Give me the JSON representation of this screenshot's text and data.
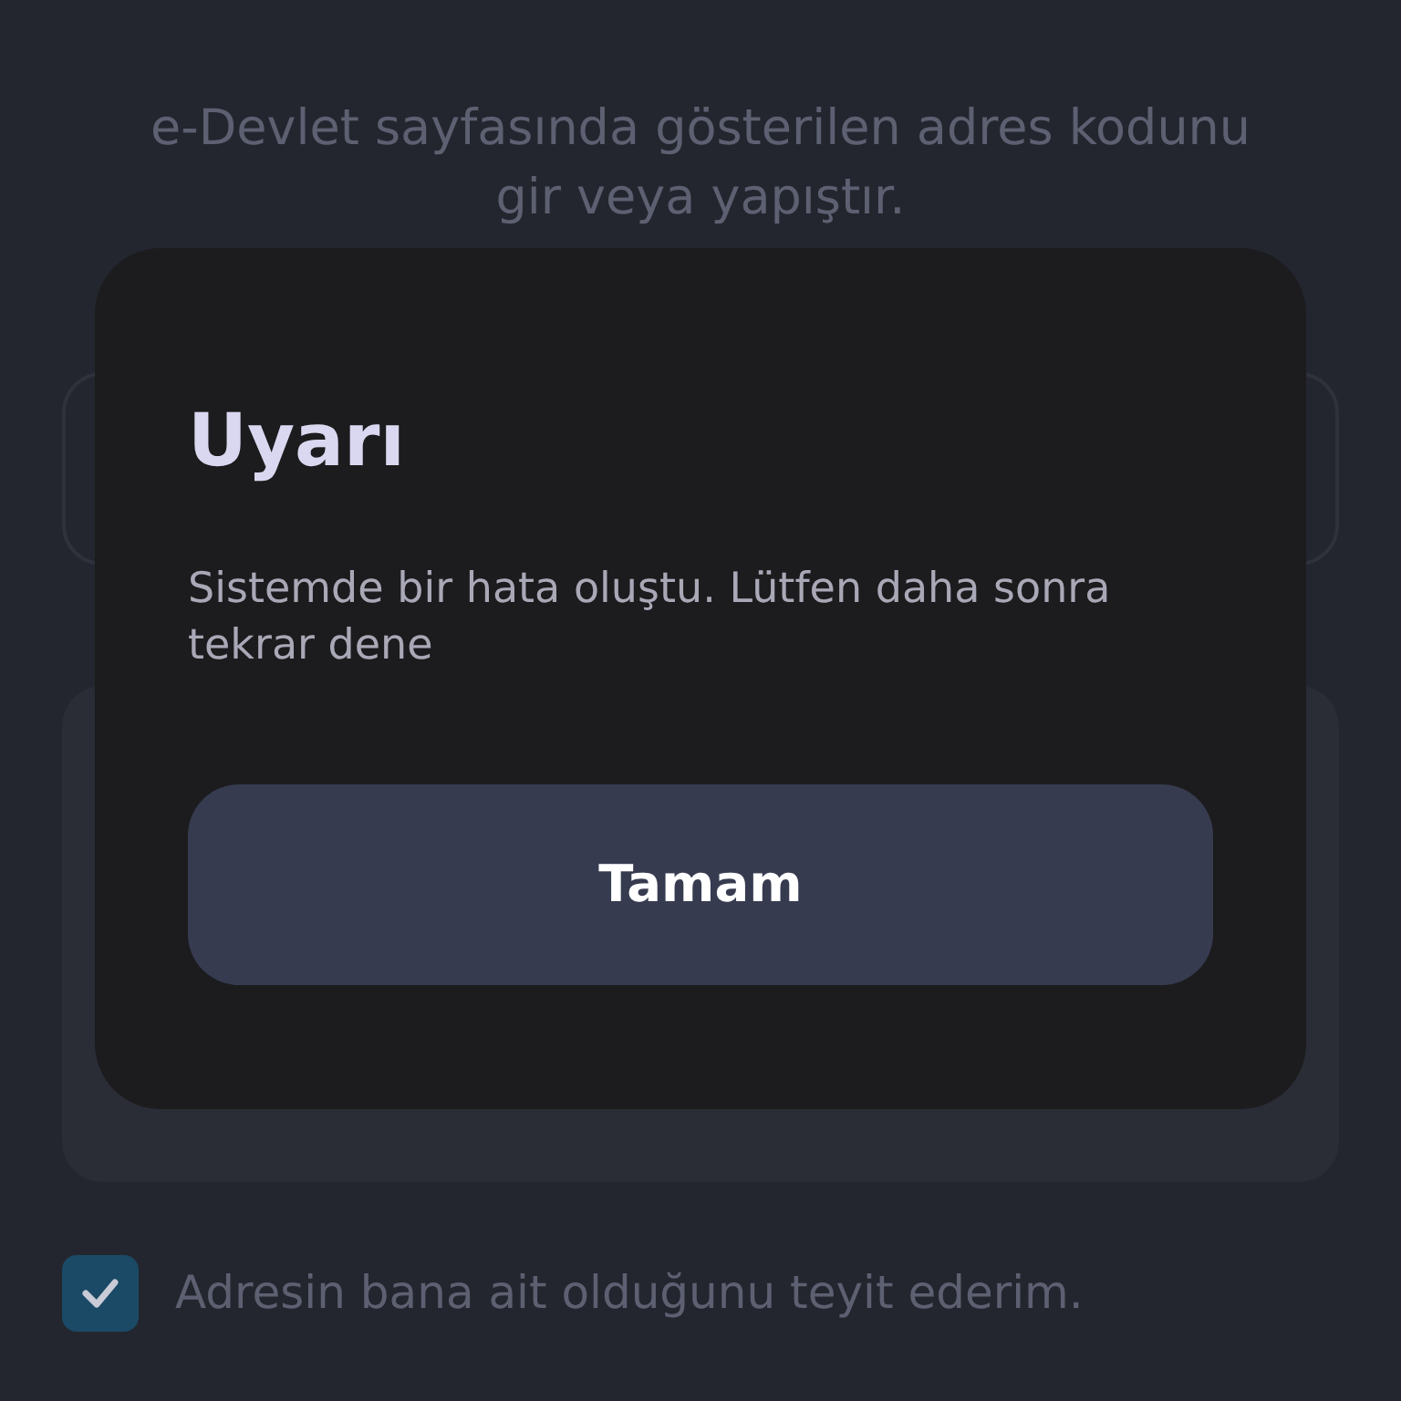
{
  "instruction": "e-Devlet sayfasında gösterilen adres kodunu gir veya yapıştır.",
  "confirm": {
    "label": "Adresin bana ait olduğunu teyit ederim.",
    "checked": true
  },
  "dialog": {
    "title": "Uyarı",
    "message": "Sistemde bir hata oluştu. Lütfen daha sonra tekrar dene",
    "button": "Tamam"
  }
}
